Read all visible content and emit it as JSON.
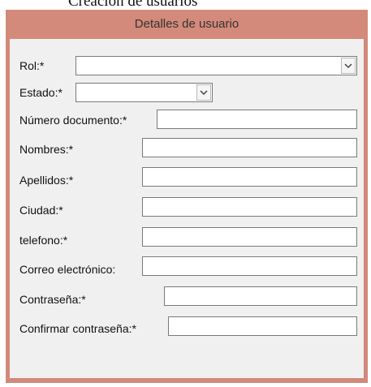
{
  "document": {
    "heading_fragment": "Creación de usuarios"
  },
  "window": {
    "title": "Detalles de usuario"
  },
  "form": {
    "rol": {
      "label": "Rol:*",
      "value": ""
    },
    "estado": {
      "label": "Estado:*",
      "value": ""
    },
    "numero_documento": {
      "label": "Número documento:*",
      "value": ""
    },
    "nombres": {
      "label": "Nombres:*",
      "value": ""
    },
    "apellidos": {
      "label": "Apellidos:*",
      "value": ""
    },
    "ciudad": {
      "label": "Ciudad:*",
      "value": ""
    },
    "telefono": {
      "label": "telefono:*",
      "value": ""
    },
    "correo": {
      "label": "Correo electrónico:",
      "value": ""
    },
    "contrasena": {
      "label": "Contraseña:*",
      "value": ""
    },
    "confirmar_contrasena": {
      "label": "Confirmar contraseña:*",
      "value": ""
    }
  },
  "colors": {
    "titlebar": "#d48a7a",
    "panel": "#f0f0f0"
  },
  "icons": {
    "dropdown": "chevron-down-icon"
  }
}
